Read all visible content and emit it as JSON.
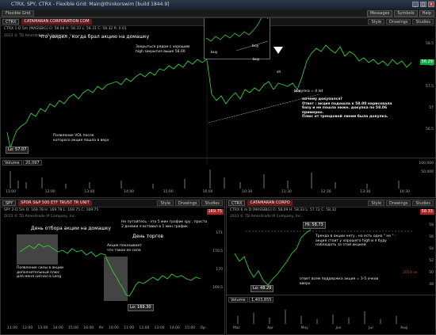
{
  "window": {
    "title": "CTRX, SPY, CTRX - Flexible Grid: Main@thinkorswim [build 1844.9]"
  },
  "tabs": {
    "active": "Flexible Grid"
  },
  "topbar": {
    "buttons": [
      "Messages",
      "Symbols",
      "Help"
    ]
  },
  "main_panel": {
    "symbol": "CTRX",
    "link_label": "CATAMARAN CORPORATION COM",
    "style_label": "Style",
    "drawings_label": "Drawings",
    "studies_label": "Studies",
    "quote_line": "CTRX 1-D 5m [MASSBIG]  O: 58.08  H: 58.33  L: 58.31  C: 58.32  R: 0.01",
    "price_tag": "56.29",
    "copyright": "2013 © TD Ameritrade IP Company, Inc.",
    "annotation_title": "Что увидел , когда брал акцию на домашку",
    "annotation_close": "Закрыться рядом с хорошим high закрытия выше 58.00",
    "annotation_volume": "Появление VOL после которого акция пошла в верх",
    "low_tag": "Lo: 57.07",
    "annotation_daily": "дохупка = 4 lot",
    "annotation_answer": "почему докупался?\nОтвет : акция подошла к 58.00 нарисовала базу и не пошла ниже. докупка по 58.06 примерно.\nПлюс от трендовой линии была докупка.",
    "marker_buy1": "buy",
    "marker_buy2": "buy",
    "marker_buy_inset": "buy",
    "marker_sh": "sh",
    "inset_buy": "buy",
    "volume_label": "Volume",
    "volume_value": "20,097",
    "price_axis": [
      "58.5",
      "58",
      "57.5",
      "57",
      "56.5"
    ],
    "volume_axis": [
      "100,000",
      "50,000"
    ],
    "time_axis": [
      "11:00",
      "11:30",
      "12:00",
      "12:30",
      "13:00",
      "13:30",
      "14:00",
      "14:30",
      "15:00",
      "15:30",
      "16:00",
      "10:00",
      "10:30",
      "11:00",
      "11:30",
      "12:00",
      "12:30",
      "13:00",
      "13:30",
      "14:00",
      "14:30",
      "15:00"
    ]
  },
  "spy_panel": {
    "symbol": "SPY",
    "link_label": "SPDR S&P 500 ETF TRUST TR UNIT",
    "style_label": "Style",
    "drawings_label": "Drawings",
    "studies_label": "Studies",
    "quote_line": "SPY 2-D 5m  O: 169.78  H: 169.78  L: 169.75  C: 169.75",
    "price_tag": "169.75",
    "copyright": "2013 © TD Ameritrade IP Company, Inc.",
    "annotation_homework_day": "День отбора акции на домашку",
    "annotation_trading_day": "День торгов",
    "annotation_long": "Появление силы в акции дополнительный плюс для меня сигнал в Long",
    "annotation_spy_day": "Не путайтесь - это 5 мин график spy , просто 2 дневки я вставил в 1 мин график",
    "annotation_spy_holds": "Акция показывает что такое ее сила",
    "low_tag": "Lo: 169.30",
    "price_axis": [
      "171",
      "170.5",
      "170",
      "169.5"
    ],
    "time_axis": [
      "11:00",
      "12:00",
      "13:00",
      "14:00",
      "15:00",
      "16:00",
      "9V",
      "10:00",
      "11:00",
      "12:00",
      "13:00",
      "14:00",
      "15:00",
      "Op"
    ]
  },
  "daily_panel": {
    "symbol": "CTRX",
    "link_label": "CATAMARAN CORPO",
    "style_label": "Style",
    "drawings_label": "Drawings",
    "studies_label": "Studies",
    "quote_line": "CTRX 6 m D [MASSBIG]  O: 58.09  H: 58.33  L: 57.72  C: 58.32",
    "price_tag": "58.33",
    "copyright": "2013 © TD Ameritrade IP Company, Inc.",
    "high_tag": "Hi: 58.73",
    "low_tag": "Lo: 48.29",
    "annotation_trend": "Тренда в акции нету , но есть одно \" но \" - акция стоит у хорошего high и я буду наблюдать за этой акцией",
    "annotation_report": "ответ всем поддержка акция = 3-5 очков вверх",
    "volume_label": "Volume",
    "volume_value": "1,403,855",
    "price_axis": [
      "58",
      "56",
      "54",
      "52",
      "50",
      "48"
    ],
    "time_axis": [
      "Mar",
      "Apr",
      "May",
      "Jun",
      "Jul",
      "Aug"
    ],
    "side_label": "2013 ve"
  }
}
